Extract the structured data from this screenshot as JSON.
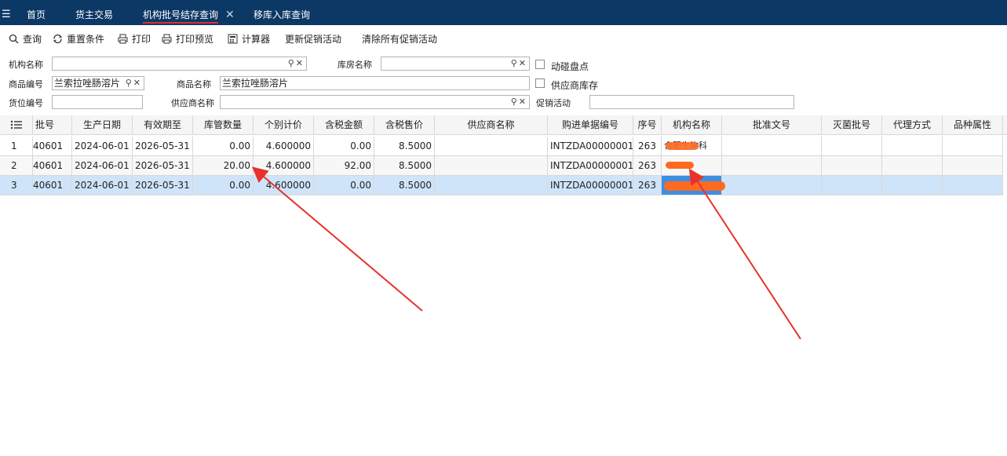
{
  "nav": {
    "tabs": [
      {
        "label": "首页",
        "active": false
      },
      {
        "label": "货主交易",
        "active": false
      },
      {
        "label": "机构批号结存查询",
        "active": true
      },
      {
        "label": "移库入库查询",
        "active": false
      }
    ],
    "close_symbol": "✕"
  },
  "toolbar": {
    "query": "查询",
    "reset": "重置条件",
    "print": "打印",
    "print_preview": "打印预览",
    "calculator": "计算器",
    "update_promo": "更新促销活动",
    "clear_promo": "清除所有促销活动"
  },
  "form": {
    "org_name_label": "机构名称",
    "org_name_value": "",
    "warehouse_label": "库房名称",
    "warehouse_value": "",
    "movement_check_label": "动碰盘点",
    "product_code_label": "商品编号",
    "product_code_value": "兰索拉唑肠溶片",
    "product_name_label": "商品名称",
    "product_name_value": "兰索拉唑肠溶片",
    "supplier_stock_label": "供应商库存",
    "location_label": "货位编号",
    "location_value": "",
    "supplier_label": "供应商名称",
    "supplier_value": "",
    "promo_label": "促销活动",
    "promo_value": ""
  },
  "table": {
    "headers": [
      "批号",
      "生产日期",
      "有效期至",
      "库管数量",
      "个别计价",
      "含税金额",
      "含税售价",
      "供应商名称",
      "购进单据编号",
      "序号",
      "机构名称",
      "批准文号",
      "灭菌批号",
      "代理方式",
      "品种属性"
    ],
    "rows": [
      {
        "idx": "1",
        "batch": "40601",
        "mfg": "2024-06-01",
        "exp": "2026-05-31",
        "qty": "0.00",
        "unit_cost": "4.600000",
        "amount": "0.00",
        "price": "8.5000",
        "supplier": "",
        "doc": "INTZDA00000001",
        "seq": "263",
        "org": "合肥生物科",
        "approval": "",
        "sterile": "",
        "agent": "",
        "attr": "",
        "selected": false
      },
      {
        "idx": "2",
        "batch": "40601",
        "mfg": "2024-06-01",
        "exp": "2026-05-31",
        "qty": "20.00",
        "unit_cost": "4.600000",
        "amount": "92.00",
        "price": "8.5000",
        "supplier": "",
        "doc": "INTZDA00000001",
        "seq": "263",
        "org": "",
        "approval": "",
        "sterile": "",
        "agent": "",
        "attr": "",
        "selected": false
      },
      {
        "idx": "3",
        "batch": "40601",
        "mfg": "2024-06-01",
        "exp": "2026-05-31",
        "qty": "0.00",
        "unit_cost": "4.600000",
        "amount": "0.00",
        "price": "8.5000",
        "supplier": "",
        "doc": "INTZDA00000001",
        "seq": "263",
        "org": "",
        "approval": "",
        "sterile": "",
        "agent": "",
        "attr": "",
        "selected": true
      }
    ]
  },
  "colors": {
    "nav_bg": "#0c3866",
    "active_tab_underline": "#e02f2f",
    "selected_row": "#cfe4f9",
    "annotation_arrow": "#e8322b",
    "redaction": "#ff6a22"
  }
}
